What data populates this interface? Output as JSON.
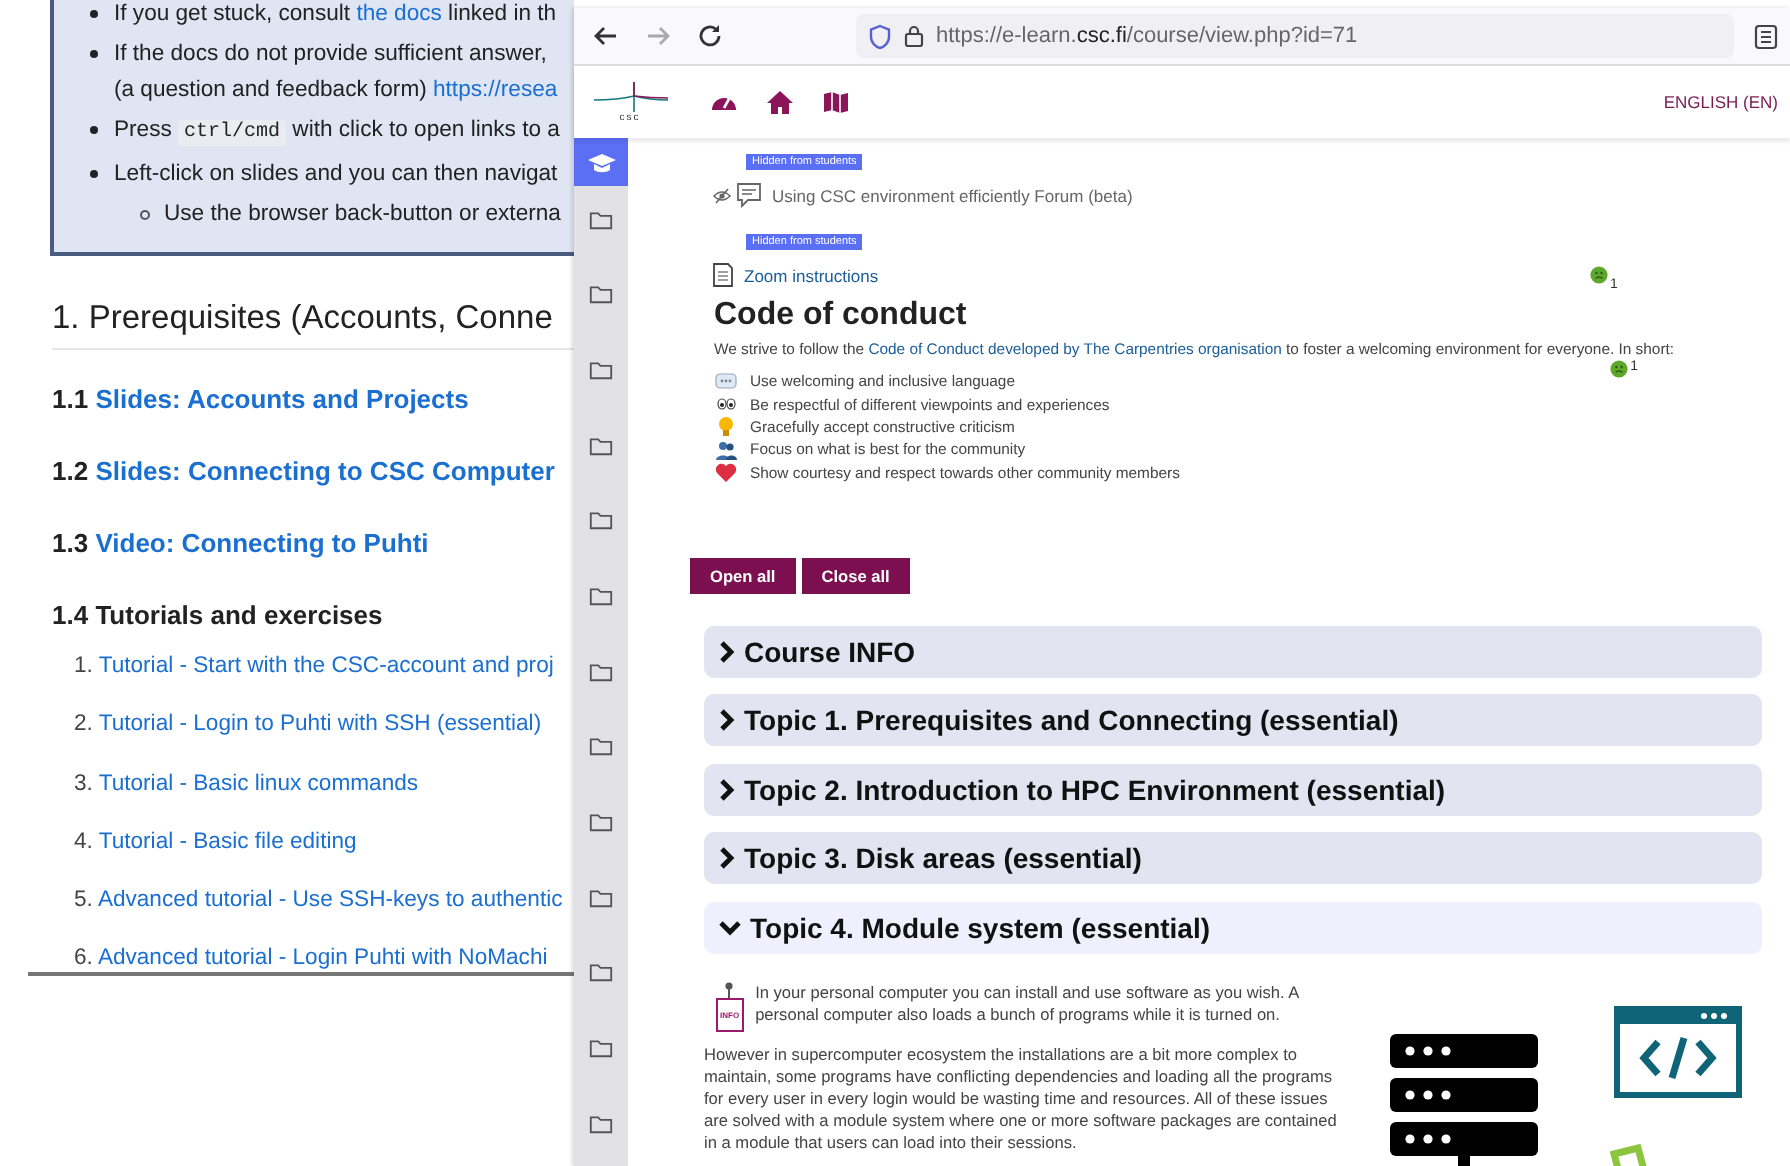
{
  "doc": {
    "notes": [
      {
        "parts": [
          {
            "kind": "text",
            "text": "If you get stuck, consult "
          },
          {
            "kind": "link",
            "text": "the docs"
          },
          {
            "kind": "text",
            "text": " linked in th"
          }
        ]
      },
      {
        "parts": [
          {
            "kind": "text",
            "text": "If the docs do not provide sufficient answer,"
          },
          {
            "kind": "break"
          },
          {
            "kind": "text",
            "text": "(a question and feedback form) "
          },
          {
            "kind": "link",
            "text": "https://resea"
          }
        ]
      },
      {
        "parts": [
          {
            "kind": "text",
            "text": "Press "
          },
          {
            "kind": "code",
            "text": "ctrl/cmd"
          },
          {
            "kind": "text",
            "text": " with click to open links to a"
          }
        ]
      },
      {
        "parts": [
          {
            "kind": "text",
            "text": "Left-click on slides and you can then navigat"
          }
        ],
        "children": [
          {
            "parts": [
              {
                "kind": "text",
                "text": "Use the browser back-button or externa"
              }
            ]
          }
        ]
      }
    ],
    "heading": "1. Prerequisites (Accounts, Conne",
    "subsections": [
      {
        "number": "1.1",
        "title": "Slides: Accounts and Projects",
        "link": true
      },
      {
        "number": "1.2",
        "title": "Slides: Connecting to CSC Computer",
        "link": true
      },
      {
        "number": "1.3",
        "title": "Video: Connecting to Puhti",
        "link": true
      },
      {
        "number": "1.4",
        "title": "Tutorials and exercises",
        "link": false
      }
    ],
    "tutorials": [
      {
        "number": "1.",
        "title": "Tutorial - Start with the CSC-account and proj"
      },
      {
        "number": "2.",
        "title": "Tutorial - Login to Puhti with SSH (essential)"
      },
      {
        "number": "3.",
        "title": "Tutorial - Basic linux commands"
      },
      {
        "number": "4.",
        "title": "Tutorial - Basic file editing"
      },
      {
        "number": "5.",
        "title": "Advanced tutorial - Use SSH-keys to authentic"
      },
      {
        "number": "6.",
        "title": "Advanced tutorial - Login Puhti with NoMachi"
      }
    ]
  },
  "browser": {
    "nav": [
      {
        "kind": "back",
        "disabled": false
      },
      {
        "kind": "forward",
        "disabled": true
      },
      {
        "kind": "reload",
        "disabled": false
      }
    ],
    "url": {
      "before": "https://e-learn.",
      "domain": "csc.fi",
      "after": "/course/view.php?id=71"
    }
  },
  "site": {
    "logo_text": "csc",
    "language": "ENGLISH (EN)",
    "drawer": [
      {
        "kind": "cap",
        "selected": true
      },
      {
        "kind": "folder",
        "selected": false
      },
      {
        "kind": "folder",
        "selected": false
      },
      {
        "kind": "folder",
        "selected": false
      },
      {
        "kind": "folder",
        "selected": false
      },
      {
        "kind": "folder",
        "selected": false
      },
      {
        "kind": "folder",
        "selected": false
      },
      {
        "kind": "folder",
        "selected": false
      },
      {
        "kind": "folder",
        "selected": false
      },
      {
        "kind": "folder",
        "selected": false
      },
      {
        "kind": "folder",
        "selected": false
      },
      {
        "kind": "folder",
        "selected": false
      },
      {
        "kind": "folder",
        "selected": false
      },
      {
        "kind": "folder",
        "selected": false
      }
    ]
  },
  "activities": [
    {
      "kind": "badge",
      "text": "Hidden from students"
    },
    {
      "kind": "forum",
      "text": "Using CSC environment efficiently Forum (beta)",
      "hidden": true
    },
    {
      "kind": "badge",
      "text": "Hidden from students"
    },
    {
      "kind": "resource",
      "text": "Zoom instructions",
      "completion": "1"
    }
  ],
  "conduct": {
    "title": "Code of conduct",
    "intro": [
      {
        "kind": "text",
        "text": "We strive to follow the "
      },
      {
        "kind": "link",
        "text": "Code of Conduct developed by The Carpentries organisation"
      },
      {
        "kind": "text",
        "text": " to foster a welcoming environment for everyone. In short:"
      }
    ],
    "completion": "1",
    "items": [
      {
        "kind": "speech",
        "text": "Use welcoming and inclusive language"
      },
      {
        "kind": "eyes",
        "text": "Be respectful of different viewpoints and experiences"
      },
      {
        "kind": "bulb",
        "text": "Gracefully accept constructive criticism"
      },
      {
        "kind": "people",
        "text": "Focus on what is best for the community"
      },
      {
        "kind": "heart",
        "text": "Show courtesy and respect towards other community members"
      }
    ]
  },
  "buttons": [
    "Open all",
    "Close all"
  ],
  "sections": [
    {
      "title": "Course INFO",
      "expanded": false
    },
    {
      "title": "Topic 1. Prerequisites and Connecting (essential)",
      "expanded": false
    },
    {
      "title": "Topic 2. Introduction to HPC Environment (essential)",
      "expanded": false
    },
    {
      "title": "Topic 3. Disk areas (essential)",
      "expanded": false
    },
    {
      "title": "Topic 4. Module system (essential)",
      "expanded": true
    }
  ],
  "module": {
    "info_label": "INFO",
    "lead": "In your personal computer you can install and use software as you wish. A personal computer also loads a bunch of programs while it is turned on.",
    "body": "However in supercomputer ecosystem the installations are a bit more complex to maintain, some programs have conflicting dependencies and loading all the programs for every user in every login would be wasting time and resources. All of these issues are solved with a module system where one or more software packages are contained in a module that users can load into their sessions."
  }
}
